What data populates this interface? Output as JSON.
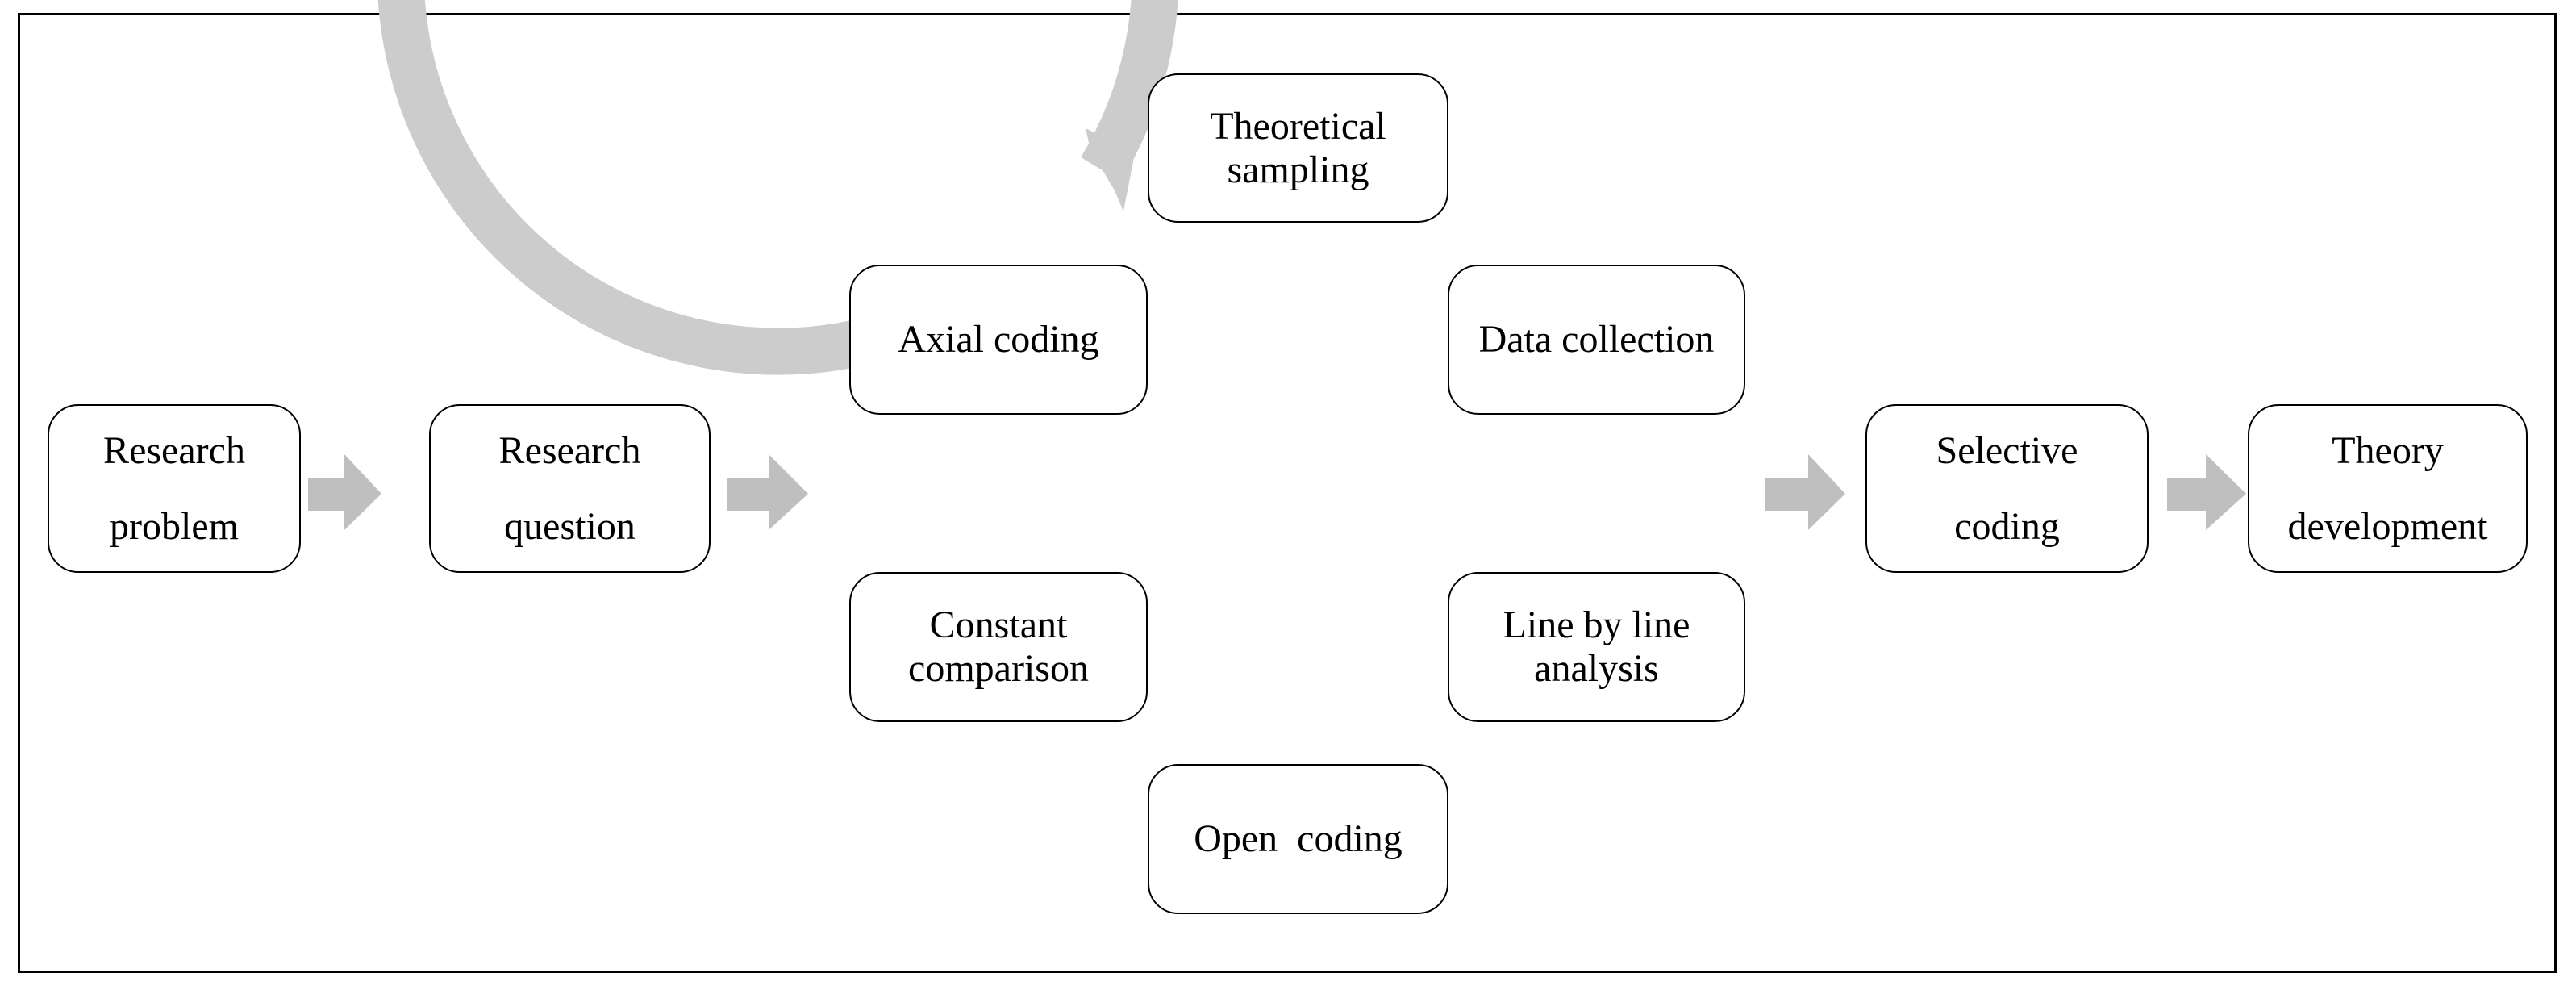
{
  "figure": {
    "type": "grounded-theory process flow",
    "colors": {
      "box_border": "#000000",
      "box_fill": "#ffffff",
      "arrow_fill": "#bfbfbf",
      "cycle_ring": "#cccccc",
      "frame_border": "#000000"
    }
  },
  "linear_steps": {
    "research_problem": [
      "Research",
      "problem"
    ],
    "research_question": [
      "Research",
      "question"
    ],
    "selective_coding": [
      "Selective",
      "coding"
    ],
    "theory_development": [
      "Theory",
      "development"
    ]
  },
  "cycle": {
    "direction": "clockwise",
    "steps": {
      "theoretical_sampling": [
        "Theoretical",
        "sampling"
      ],
      "data_collection": [
        "Data collection"
      ],
      "line_by_line_analysis": [
        "Line by line",
        "analysis"
      ],
      "open_coding": [
        "Open  coding"
      ],
      "constant_comparison": [
        "Constant",
        "comparison"
      ],
      "axial_coding": [
        "Axial coding"
      ]
    }
  },
  "edges": [
    {
      "from": "Research problem",
      "to": "Research question"
    },
    {
      "from": "Research question",
      "to": "cycle"
    },
    {
      "from": "cycle",
      "to": "Selective coding"
    },
    {
      "from": "Selective coding",
      "to": "Theory development"
    },
    {
      "from": "Axial coding",
      "to": "Theoretical sampling",
      "style": "curved cycle arrow"
    }
  ]
}
